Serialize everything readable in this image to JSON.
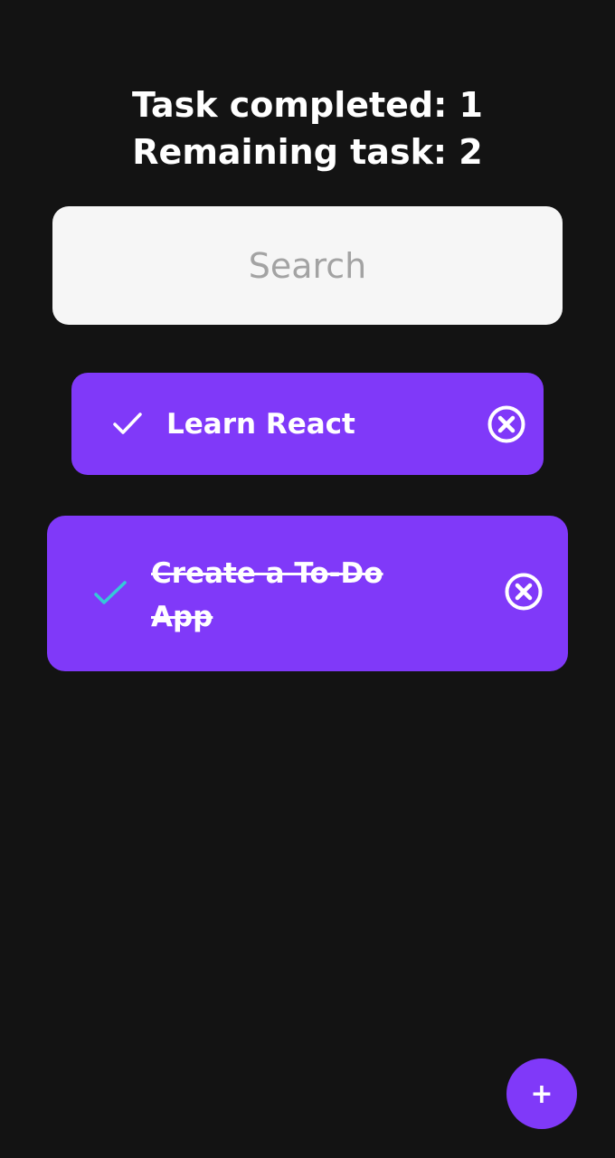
{
  "stats": {
    "completed_text": "Task completed: 1",
    "remaining_text": "Remaining task: 2"
  },
  "search": {
    "placeholder": "Search",
    "value": ""
  },
  "tasks": [
    {
      "label": "Learn React",
      "completed": false,
      "check_icon": "check-icon",
      "check_color": "#ffffff",
      "remove_icon": "close-circle-icon"
    },
    {
      "label": "Create a To-Do App",
      "completed": true,
      "check_icon": "check-icon",
      "check_color": "#35c8d8",
      "remove_icon": "close-circle-icon"
    }
  ],
  "fab": {
    "label": "+",
    "icon": "plus-icon"
  },
  "colors": {
    "background": "#131313",
    "accent": "#8039f9",
    "search_bg": "#f6f6f6",
    "completed_check": "#35c8d8",
    "text": "#ffffff"
  }
}
